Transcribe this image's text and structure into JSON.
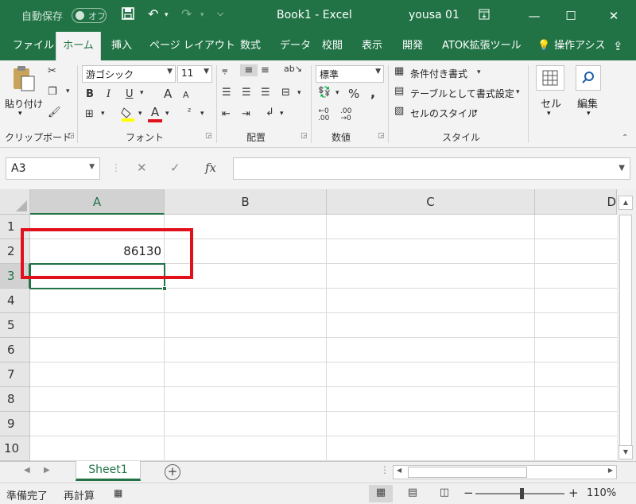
{
  "titlebar": {
    "autosave_label": "自動保存",
    "autosave_state": "オフ",
    "doc_title": "Book1  -  Excel",
    "user": "yousa 01",
    "icons": [
      "save-icon",
      "undo-icon",
      "redo-icon",
      "customize-qat-icon",
      "ribbon-display-icon",
      "minimize-icon",
      "maximize-icon",
      "close-icon"
    ]
  },
  "tabs": [
    "ファイル",
    "ホーム",
    "挿入",
    "ページ レイアウト",
    "数式",
    "データ",
    "校閲",
    "表示",
    "開発",
    "ATOK拡張ツール",
    "操作アシス"
  ],
  "active_tab": "ホーム",
  "ribbon": {
    "clipboard": {
      "paste_label": "貼り付け",
      "group_label": "クリップボード"
    },
    "font": {
      "font_name": "游ゴシック",
      "font_size": "11",
      "bold": "B",
      "italic": "I",
      "underline": "U",
      "grow": "A",
      "shrink": "A",
      "font_color_glyph": "A",
      "group_label": "フォント"
    },
    "alignment": {
      "group_label": "配置"
    },
    "number": {
      "format": "標準",
      "percent": "%",
      "comma": ",",
      "group_label": "数値"
    },
    "styles": {
      "conditional": "条件付き書式",
      "table": "テーブルとして書式設定",
      "cell_styles": "セルのスタイル",
      "group_label": "スタイル"
    },
    "cells": {
      "label": "セル"
    },
    "editing": {
      "label": "編集"
    }
  },
  "formula_bar": {
    "name_box": "A3",
    "fx": "fx",
    "formula_value": ""
  },
  "grid": {
    "columns": [
      "A",
      "B",
      "C",
      "D"
    ],
    "selected_column": "A",
    "rows": [
      "1",
      "2",
      "3",
      "4",
      "5",
      "6",
      "7",
      "8",
      "9",
      "10"
    ],
    "selected_row": "3",
    "cells": {
      "A2": "86130"
    },
    "active_cell": "A3"
  },
  "sheets": {
    "tabs": [
      "Sheet1"
    ]
  },
  "statusbar": {
    "ready": "準備完了",
    "recalc": "再計算",
    "zoom": "110%"
  },
  "colors": {
    "excel_green": "#217346",
    "highlight_red": "#e0101c",
    "ribbon_bg": "#f3f3f3"
  }
}
